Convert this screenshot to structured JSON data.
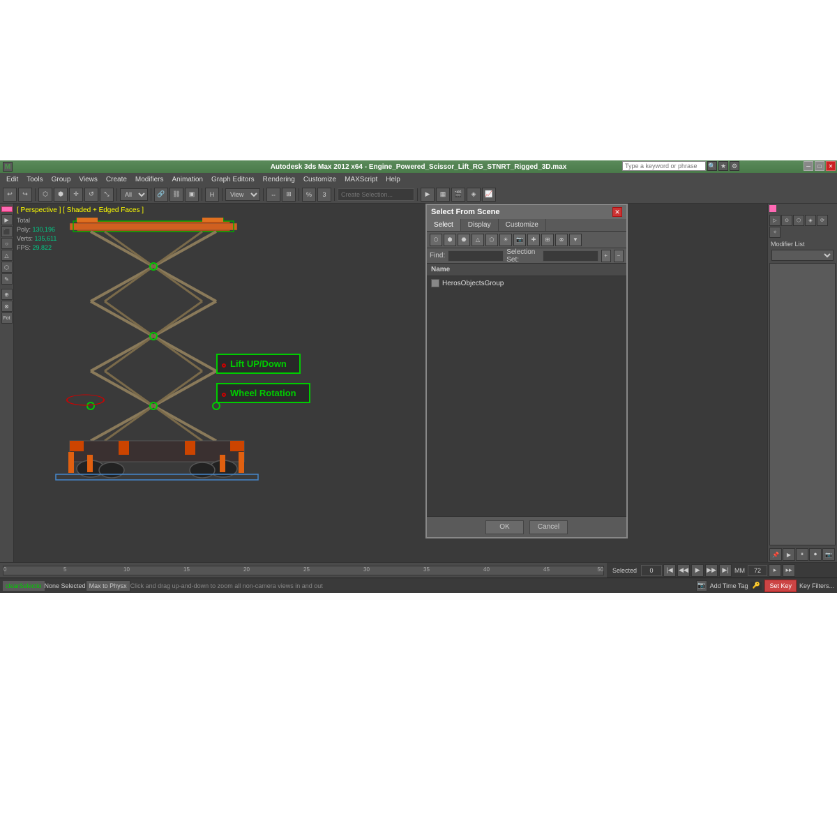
{
  "app": {
    "title": "Autodesk 3ds Max 2012 x64 - Engine_Powered_Scissor_Lift_RG_STNRT_Rigged_3D.max",
    "search_placeholder": "Type a keyword or phrase"
  },
  "menu": {
    "items": [
      "Edit",
      "Tools",
      "Group",
      "Views",
      "Create",
      "Modifiers",
      "Animation",
      "Graph Editors",
      "Rendering",
      "Customize",
      "MAXScript",
      "Help"
    ]
  },
  "viewport": {
    "label": "[ Perspective ] [ Shaded + Edged Faces ]",
    "stats": {
      "total_label": "Total",
      "poly_label": "Poly:",
      "poly_value": "130,196",
      "verts_label": "Verts:",
      "verts_value": "135,611",
      "fps_label": "FPS:",
      "fps_value": "29.822"
    }
  },
  "lift_labels": {
    "lift_up_down": "Lift UP/Down",
    "wheel_rotation": "Wheel Rotation"
  },
  "dialog": {
    "title": "Select From Scene",
    "tabs": [
      "Select",
      "Display",
      "Customize"
    ],
    "find_label": "Find:",
    "selection_set_label": "Selection Set:",
    "name_header": "Name",
    "list_items": [
      "HerosObjectsGroup"
    ],
    "ok_button": "OK",
    "cancel_button": "Cancel"
  },
  "right_panel": {
    "modifier_list_label": "Modifier List"
  },
  "status_bar": {
    "clear_selection": "clearSelectio",
    "none_selected": "None Selected",
    "hint": "Click and drag up-and-down to zoom all non-camera views in and out",
    "add_time_tag": "Add Time Tag",
    "set_key": "Set Key",
    "key_filters": "Key Filters...",
    "selected": "Selected",
    "frame": "0",
    "fot_label": "Fot"
  },
  "toolbar": {
    "view_dropdown": "View",
    "all_dropdown": "All",
    "create_selection_placeholder": "Create Selection...",
    "mm_label": "MM",
    "frame_value": "72"
  },
  "colors": {
    "accent_green": "#4a7a4a",
    "highlight_green": "#00cc00",
    "warning_red": "#cc2222",
    "orange": "#e06010",
    "background": "#3c3c3c",
    "dialog_bg": "#5a5a5a",
    "pink_accent": "#ff69b4"
  }
}
